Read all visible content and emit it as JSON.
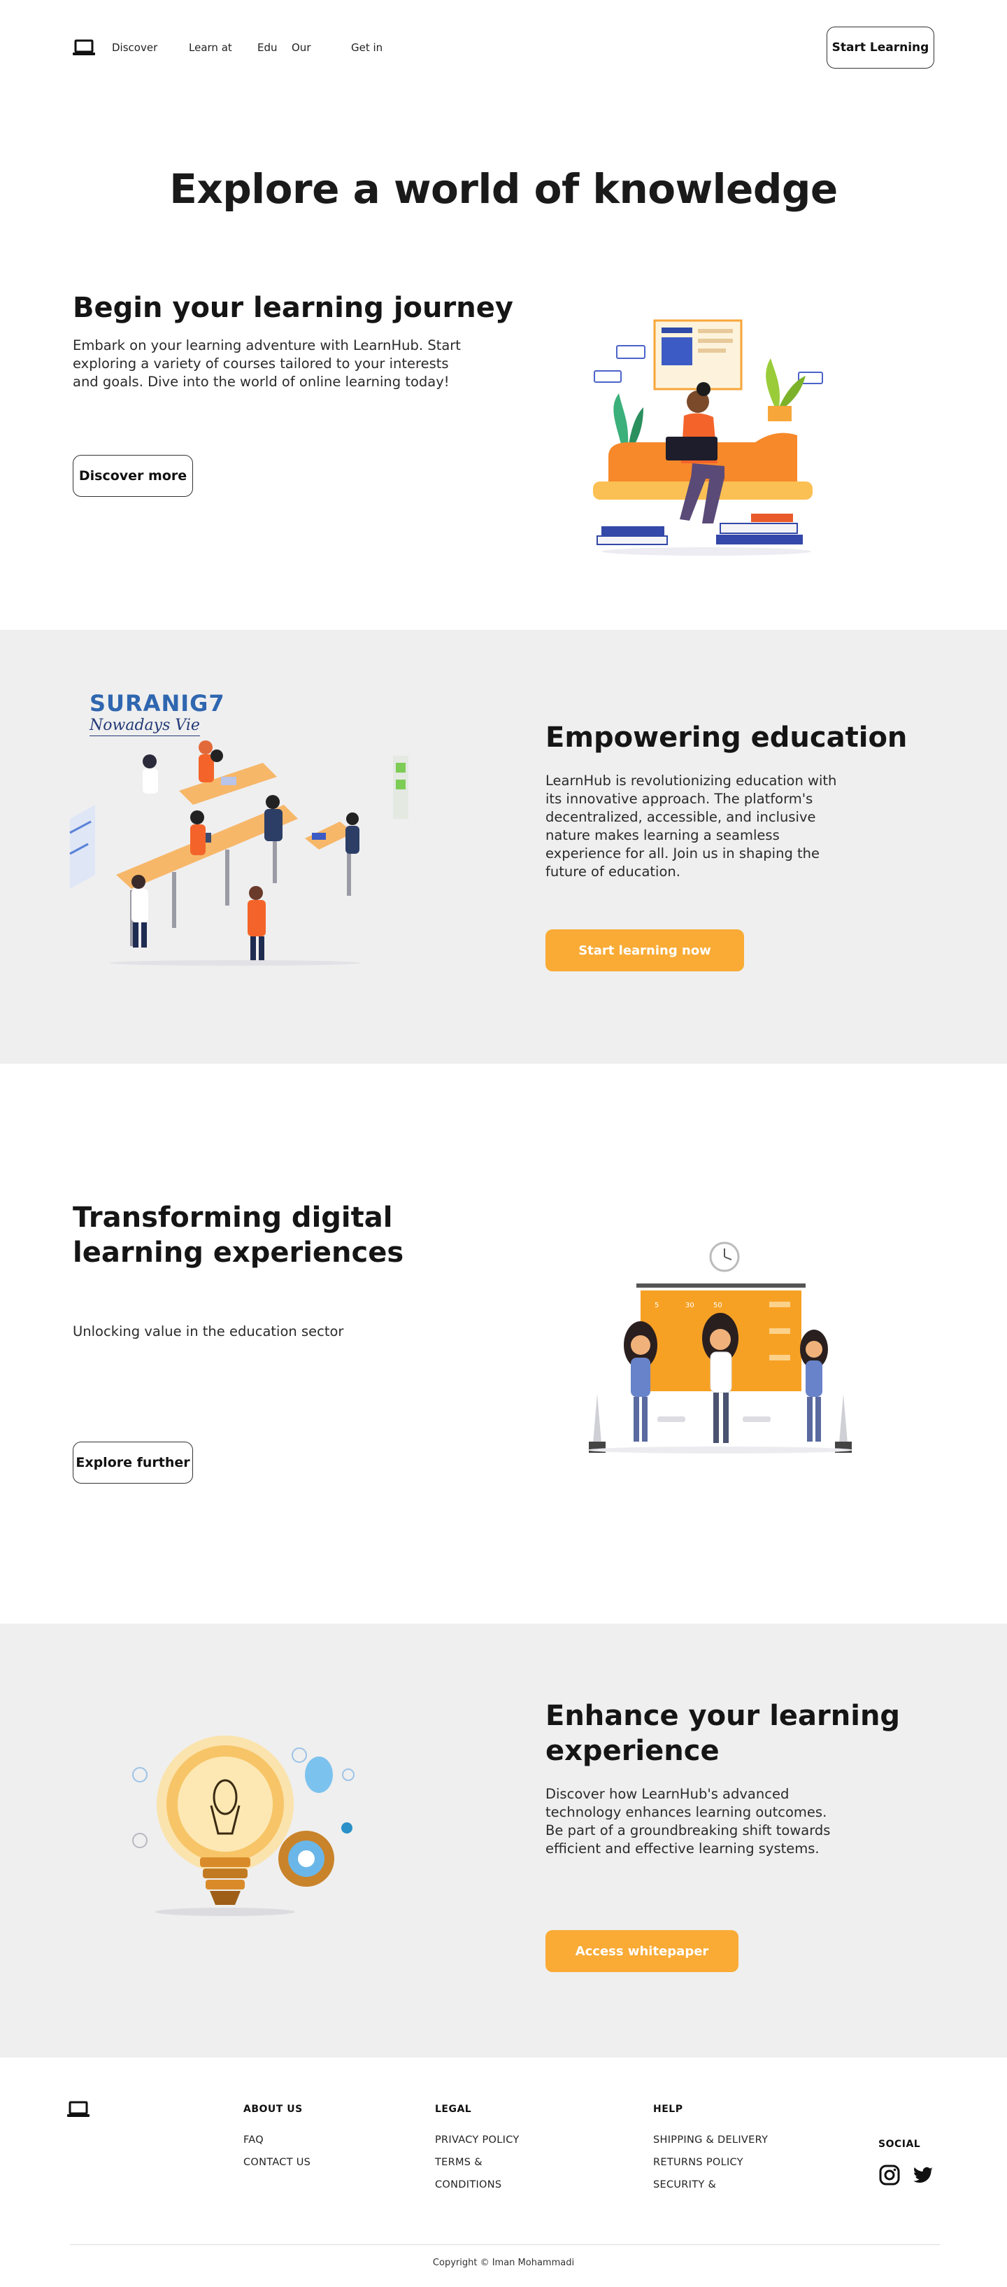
{
  "header": {
    "logo_icon": "laptop-icon",
    "nav": [
      "Discover",
      "Learn at",
      "Edu",
      "Our",
      "Get in"
    ],
    "cta_label": "Start Learning"
  },
  "hero": {
    "title": "Explore a world of knowledge"
  },
  "section1": {
    "title": "Begin your learning journey",
    "text": "Embark on your learning adventure with LearnHub. Start exploring a variety of courses tailored to your interests and goals. Dive into the world of online learning today!",
    "button_label": "Discover more",
    "illustration": "woman-with-laptop-illustration"
  },
  "section2": {
    "image_caption_title": "SURANIG7",
    "image_caption_sub": "Nowadays Vie",
    "title": "Empowering education",
    "text": "LearnHub is revolutionizing education with its innovative approach. The platform's decentralized, accessible, and inclusive nature makes learning a seamless experience for all. Join us in shaping the future of education.",
    "button_label": "Start learning now",
    "illustration": "classroom-desks-illustration"
  },
  "section3": {
    "title": "Transforming digital learning experiences",
    "text": "Unlocking value in the education sector",
    "button_label": "Explore further",
    "illustration": "students-at-board-illustration"
  },
  "section4": {
    "title": "Enhance your learning experience",
    "text": "Discover how LearnHub's advanced technology enhances learning outcomes. Be part of a groundbreaking shift towards efficient and effective learning systems.",
    "button_label": "Access whitepaper",
    "illustration": "lightbulb-gear-illustration"
  },
  "footer": {
    "logo_icon": "laptop-icon",
    "about_heading": "ABOUT US",
    "about_links": [
      "FAQ",
      "CONTACT US"
    ],
    "legal_heading": "LEGAL",
    "legal_links": [
      "PRIVACY POLICY",
      "TERMS &",
      "CONDITIONS"
    ],
    "help_heading": "HELP",
    "help_links": [
      "SHIPPING & DELIVERY",
      "RETURNS POLICY",
      "SECURITY &"
    ],
    "social_heading": "SOCIAL",
    "social_icons": [
      "instagram-icon",
      "twitter-icon"
    ],
    "copyright": "Copyright © Iman Mohammadi"
  },
  "colors": {
    "accent_orange": "#f9ab35",
    "section_gray": "#efefef",
    "text_dark": "#151515"
  }
}
